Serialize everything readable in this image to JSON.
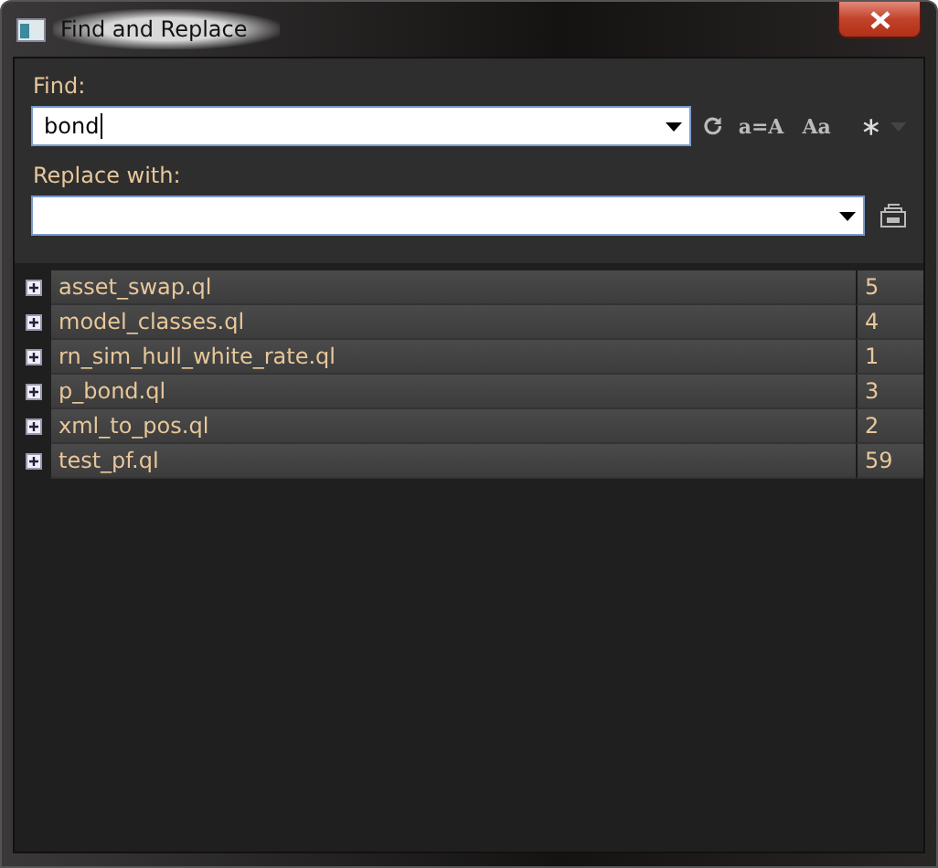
{
  "window": {
    "title": "Find and Replace"
  },
  "find": {
    "label": "Find:",
    "value": "bond"
  },
  "find_options": [
    {
      "kind": "text",
      "label": "a=A"
    },
    {
      "kind": "text",
      "label": "Aa"
    }
  ],
  "replace": {
    "label": "Replace with:"
  },
  "results": [
    {
      "file": "asset_swap.ql",
      "count": "5",
      "expanded": false
    },
    {
      "file": "model_classes.ql",
      "count": "4",
      "expanded": false
    },
    {
      "file": "rn_sim_hull_white_rate.ql",
      "count": "1",
      "expanded": false
    },
    {
      "file": "p_bond.ql",
      "count": "3",
      "expanded": false
    },
    {
      "file": "xml_to_pos.ql",
      "count": "2",
      "expanded": false
    },
    {
      "file": "test_pf.ql",
      "count": "59",
      "expanded": false
    }
  ]
}
